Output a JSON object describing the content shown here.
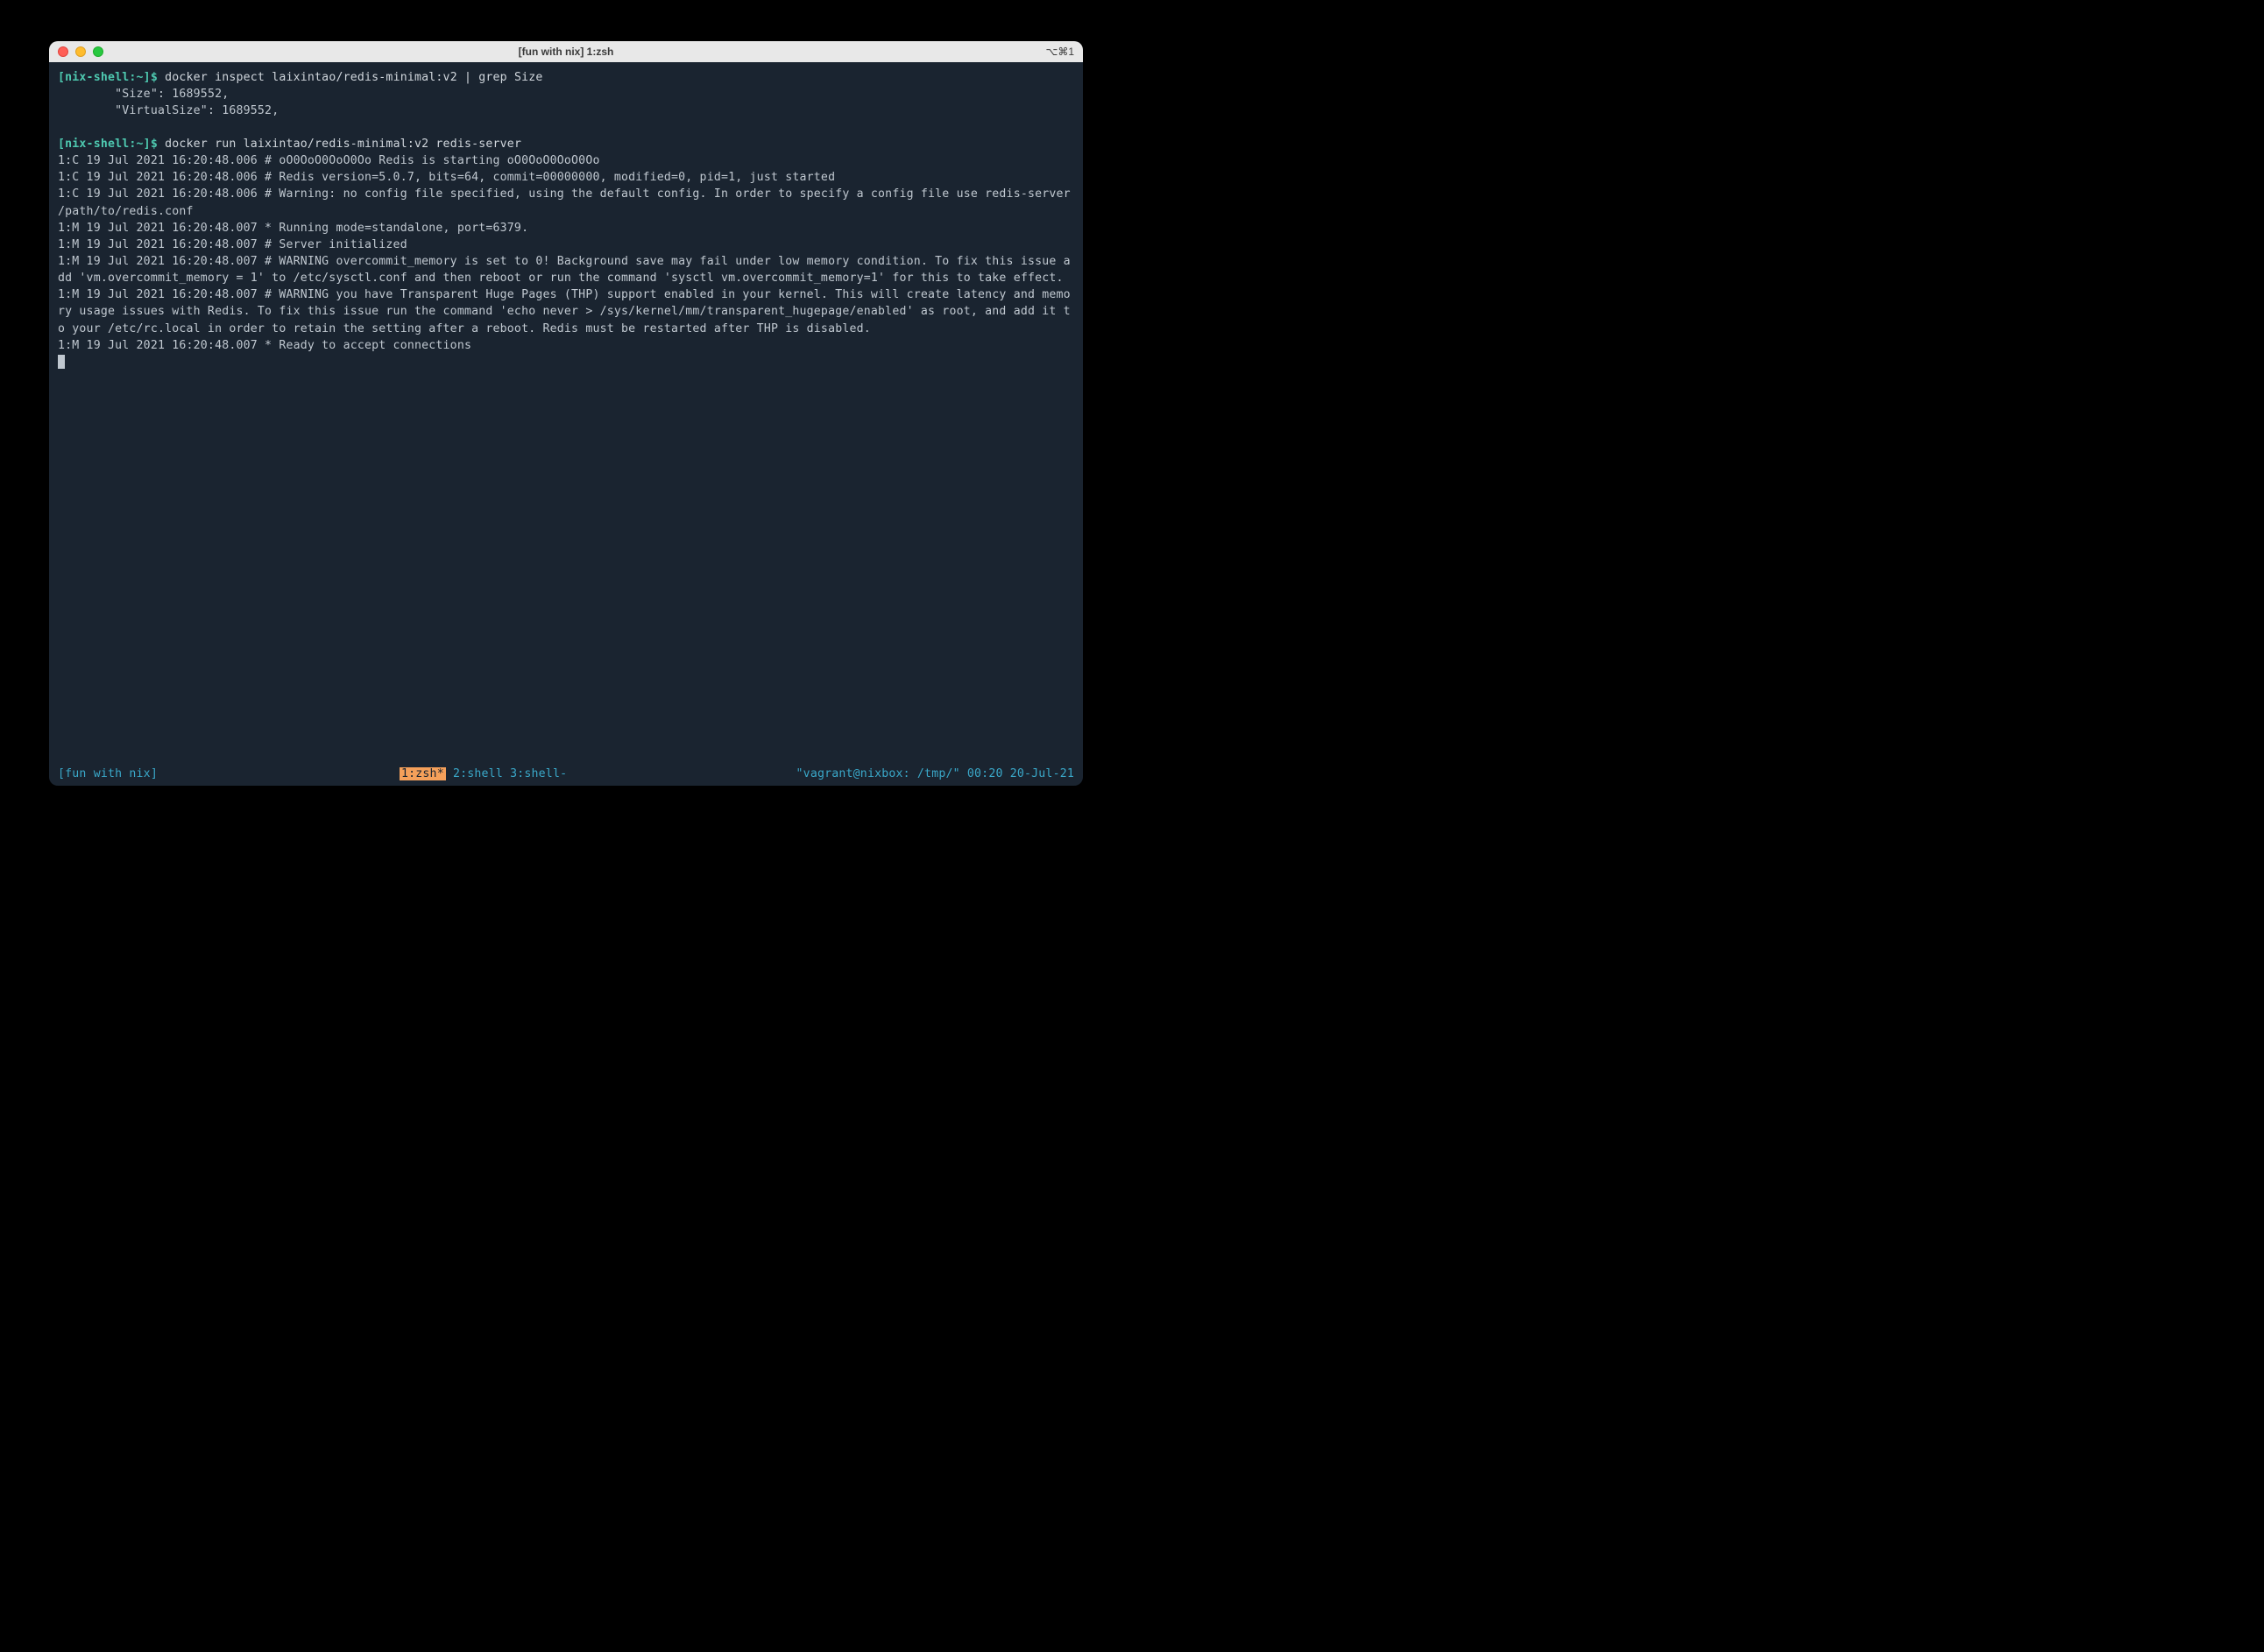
{
  "titlebar": {
    "title": "[fun with nix] 1:zsh",
    "right": "⌥⌘1"
  },
  "prompts": {
    "p1": "[nix-shell:~]$",
    "p2": "[nix-shell:~]$"
  },
  "commands": {
    "c1": " docker inspect laixintao/redis-minimal:v2 | grep Size",
    "c2": " docker run laixintao/redis-minimal:v2 redis-server"
  },
  "output": {
    "o1a": "        \"Size\": 1689552,",
    "o1b": "        \"VirtualSize\": 1689552,",
    "o2": "1:C 19 Jul 2021 16:20:48.006 # oO0OoO0OoO0Oo Redis is starting oO0OoO0OoO0Oo\n1:C 19 Jul 2021 16:20:48.006 # Redis version=5.0.7, bits=64, commit=00000000, modified=0, pid=1, just started\n1:C 19 Jul 2021 16:20:48.006 # Warning: no config file specified, using the default config. In order to specify a config file use redis-server /path/to/redis.conf\n1:M 19 Jul 2021 16:20:48.007 * Running mode=standalone, port=6379.\n1:M 19 Jul 2021 16:20:48.007 # Server initialized\n1:M 19 Jul 2021 16:20:48.007 # WARNING overcommit_memory is set to 0! Background save may fail under low memory condition. To fix this issue add 'vm.overcommit_memory = 1' to /etc/sysctl.conf and then reboot or run the command 'sysctl vm.overcommit_memory=1' for this to take effect.\n1:M 19 Jul 2021 16:20:48.007 # WARNING you have Transparent Huge Pages (THP) support enabled in your kernel. This will create latency and memory usage issues with Redis. To fix this issue run the command 'echo never > /sys/kernel/mm/transparent_hugepage/enabled' as root, and add it to your /etc/rc.local in order to retain the setting after a reboot. Redis must be restarted after THP is disabled.\n1:M 19 Jul 2021 16:20:48.007 * Ready to accept connections"
  },
  "statusbar": {
    "session": "[fun with nix]",
    "tab_active": "1:zsh*",
    "tab2": " 2:shell ",
    "tab3": " 3:shell-",
    "right": "\"vagrant@nixbox: /tmp/\" 00:20 20-Jul-21"
  }
}
